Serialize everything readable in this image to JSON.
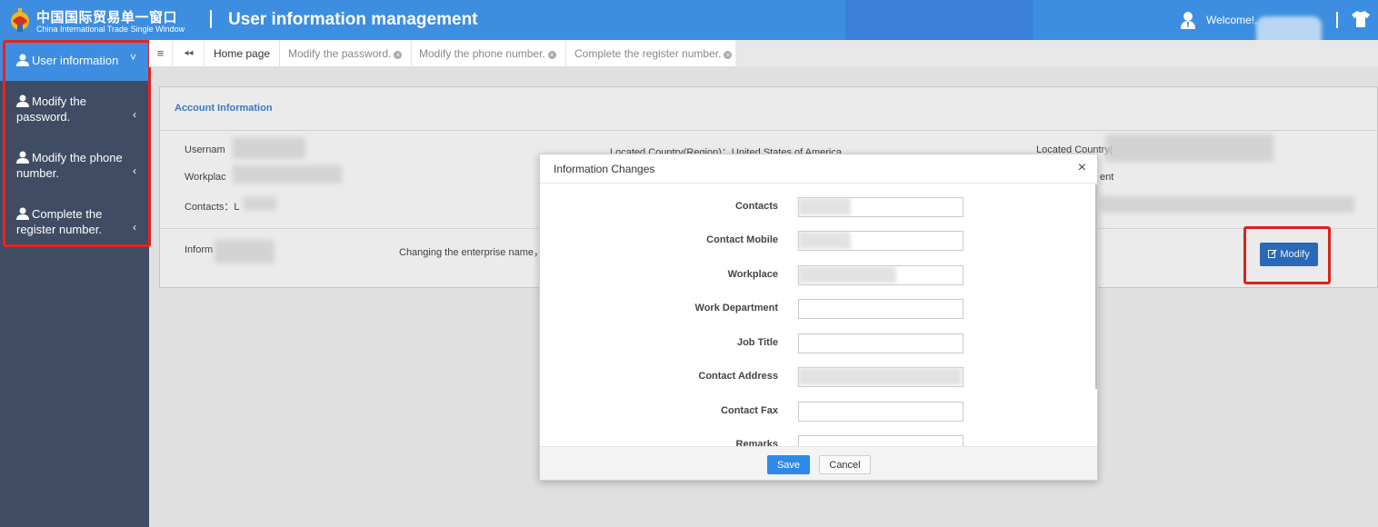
{
  "header": {
    "brand_cn": "中国国际贸易单一窗口",
    "brand_en": "China International Trade Single Window",
    "title": "User information management",
    "welcome": "Welcome!,",
    "bg_color": "#3d8ee0"
  },
  "sidebar": {
    "items": [
      {
        "label": "User information",
        "chevron": "˅",
        "active": true
      },
      {
        "label": "Modify the password.",
        "chevron": "‹"
      },
      {
        "label": "Modify the phone number.",
        "chevron": "‹"
      },
      {
        "label": "Complete the register number.",
        "chevron": "‹"
      }
    ]
  },
  "tabs": {
    "menu_icon": "≡",
    "back_icon": "◂◂",
    "items": [
      {
        "label": "Home page"
      },
      {
        "label": "Modify the password."
      },
      {
        "label": "Modify the phone number."
      },
      {
        "label": "Complete the register number."
      }
    ],
    "close_glyph": "×"
  },
  "account": {
    "title": "Account Information",
    "username_label": "Usernam",
    "workplace_label": "Workplac",
    "contacts_label": "Contacts：",
    "contacts_value": "L",
    "info_label": "Inform",
    "country_label": "Located Country(Region)：",
    "country_value": "United States of America",
    "country_label2": "Located Country(",
    "dept_label_frag": "ent",
    "notice": "Changing the enterprise name，c",
    "modify_button": "Modify"
  },
  "modal": {
    "title": "Information Changes",
    "close": "×",
    "fields": [
      {
        "label": "Contacts",
        "value": ""
      },
      {
        "label": "Contact Mobile",
        "value": ""
      },
      {
        "label": "Workplace",
        "value": ""
      },
      {
        "label": "Work Department",
        "value": ""
      },
      {
        "label": "Job Title",
        "value": ""
      },
      {
        "label": "Contact Address",
        "value": ""
      },
      {
        "label": "Contact Fax",
        "value": ""
      },
      {
        "label": "Remarks",
        "value": ""
      }
    ],
    "save": "Save",
    "cancel": "Cancel"
  },
  "colors": {
    "accent": "#3d8ee0",
    "sidebar": "#404c63",
    "highlight": "#e8231f",
    "primary_button": "#2e8ae6"
  }
}
